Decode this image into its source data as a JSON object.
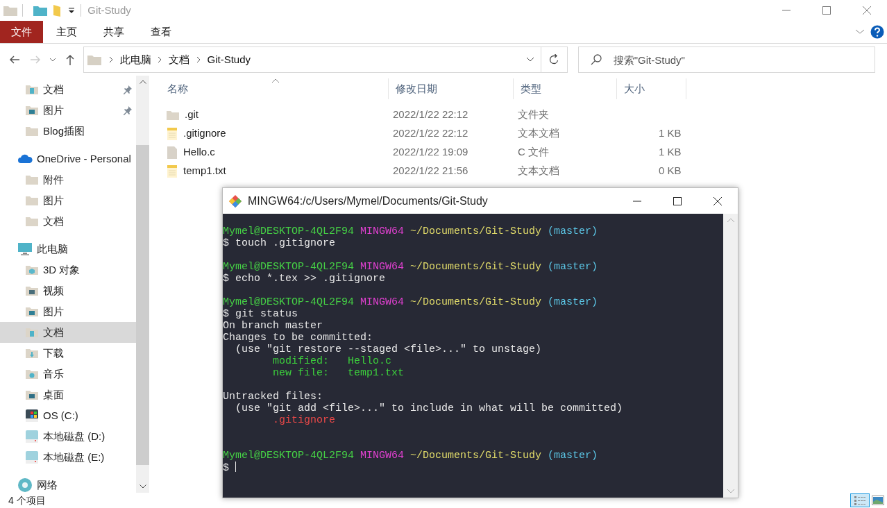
{
  "window": {
    "title": "Git-Study"
  },
  "ribbon": {
    "tabs": [
      {
        "label": "文件",
        "selected": true
      },
      {
        "label": "主页",
        "selected": false
      },
      {
        "label": "共享",
        "selected": false
      },
      {
        "label": "查看",
        "selected": false
      }
    ]
  },
  "address": {
    "breadcrumb": [
      "此电脑",
      "文档",
      "Git-Study"
    ]
  },
  "search": {
    "placeholder": "搜索\"Git-Study\""
  },
  "sidebar": {
    "items": [
      {
        "label": "文档",
        "kind": "documents",
        "pinned": true,
        "selected": false
      },
      {
        "label": "图片",
        "kind": "pictures",
        "pinned": true,
        "selected": false
      },
      {
        "label": "Blog插图",
        "kind": "folder",
        "pinned": false,
        "selected": false
      },
      {
        "label": "OneDrive - Personal",
        "kind": "onedrive",
        "selected": false,
        "children": [
          {
            "label": "附件",
            "kind": "folder",
            "selected": false
          },
          {
            "label": "图片",
            "kind": "folder",
            "selected": false
          },
          {
            "label": "文档",
            "kind": "folder",
            "selected": false
          }
        ]
      },
      {
        "label": "此电脑",
        "kind": "computer",
        "selected": false,
        "children": [
          {
            "label": "3D 对象",
            "kind": "objects3d",
            "selected": false
          },
          {
            "label": "视频",
            "kind": "videos",
            "selected": false
          },
          {
            "label": "图片",
            "kind": "pictures",
            "selected": false
          },
          {
            "label": "文档",
            "kind": "documents",
            "selected": true
          },
          {
            "label": "下载",
            "kind": "downloads",
            "selected": false
          },
          {
            "label": "音乐",
            "kind": "music",
            "selected": false
          },
          {
            "label": "桌面",
            "kind": "desktop",
            "selected": false
          },
          {
            "label": "OS (C:)",
            "kind": "os-drive",
            "selected": false
          },
          {
            "label": "本地磁盘 (D:)",
            "kind": "drive",
            "selected": false
          },
          {
            "label": "本地磁盘 (E:)",
            "kind": "drive",
            "selected": false
          }
        ]
      },
      {
        "label": "网络",
        "kind": "network",
        "selected": false
      }
    ]
  },
  "files": {
    "columns": [
      "名称",
      "修改日期",
      "类型",
      "大小"
    ],
    "rows": [
      {
        "name": ".git",
        "kind": "folder",
        "modified": "2022/1/22 22:12",
        "type": "文件夹"
      },
      {
        "name": ".gitignore",
        "kind": "text",
        "modified": "2022/1/22 22:12",
        "type": "文本文档",
        "size": "1 KB"
      },
      {
        "name": "Hello.c",
        "kind": "c-file",
        "modified": "2022/1/22 19:09",
        "type": "C 文件",
        "size": "1 KB"
      },
      {
        "name": "temp1.txt",
        "kind": "text",
        "modified": "2022/1/22 21:56",
        "type": "文本文档",
        "size": "0 KB"
      }
    ]
  },
  "status_bar": {
    "count": "4 个项目"
  },
  "terminal": {
    "title": "MINGW64:/c/Users/Mymel/Documents/Git-Study",
    "lines": [
      {
        "kind": "text",
        "segments": [
          {
            "text": "Mymel@DESKTOP-4QL2F94",
            "kind": "user"
          },
          {
            "text": " MINGW64",
            "kind": "host"
          },
          {
            "text": " ~/Documents/Git-Study",
            "kind": "path"
          },
          {
            "text": " (master)",
            "kind": "branch"
          }
        ]
      },
      {
        "kind": "text",
        "segments": [
          {
            "text": "$ touch .gitignore",
            "kind": "plain"
          }
        ]
      },
      {
        "kind": "blank"
      },
      {
        "kind": "text",
        "segments": [
          {
            "text": "Mymel@DESKTOP-4QL2F94",
            "kind": "user"
          },
          {
            "text": " MINGW64",
            "kind": "host"
          },
          {
            "text": " ~/Documents/Git-Study",
            "kind": "path"
          },
          {
            "text": " (master)",
            "kind": "branch"
          }
        ]
      },
      {
        "kind": "text",
        "segments": [
          {
            "text": "$ echo *.tex >> .gitignore",
            "kind": "plain"
          }
        ]
      },
      {
        "kind": "blank"
      },
      {
        "kind": "text",
        "segments": [
          {
            "text": "Mymel@DESKTOP-4QL2F94",
            "kind": "user"
          },
          {
            "text": " MINGW64",
            "kind": "host"
          },
          {
            "text": " ~/Documents/Git-Study",
            "kind": "path"
          },
          {
            "text": " (master)",
            "kind": "branch"
          }
        ]
      },
      {
        "kind": "text",
        "segments": [
          {
            "text": "$ git status",
            "kind": "plain"
          }
        ]
      },
      {
        "kind": "text",
        "segments": [
          {
            "text": "On branch master",
            "kind": "plain"
          }
        ]
      },
      {
        "kind": "text",
        "segments": [
          {
            "text": "Changes to be committed:",
            "kind": "plain"
          }
        ]
      },
      {
        "kind": "text",
        "segments": [
          {
            "text": "  (use \"git restore --staged <file>...\" to unstage)",
            "kind": "plain"
          }
        ]
      },
      {
        "kind": "text",
        "segments": [
          {
            "text": "        modified:   Hello.c",
            "kind": "staged"
          }
        ]
      },
      {
        "kind": "text",
        "segments": [
          {
            "text": "        new file:   temp1.txt",
            "kind": "staged"
          }
        ]
      },
      {
        "kind": "blank"
      },
      {
        "kind": "text",
        "segments": [
          {
            "text": "Untracked files:",
            "kind": "plain"
          }
        ]
      },
      {
        "kind": "text",
        "segments": [
          {
            "text": "  (use \"git add <file>...\" to include in what will be committed)",
            "kind": "plain"
          }
        ]
      },
      {
        "kind": "text",
        "segments": [
          {
            "text": "        .gitignore",
            "kind": "untracked"
          }
        ]
      },
      {
        "kind": "blank"
      },
      {
        "kind": "blank"
      },
      {
        "kind": "text",
        "segments": [
          {
            "text": "Mymel@DESKTOP-4QL2F94",
            "kind": "user"
          },
          {
            "text": " MINGW64",
            "kind": "host"
          },
          {
            "text": " ~/Documents/Git-Study",
            "kind": "path"
          },
          {
            "text": " (master)",
            "kind": "branch"
          }
        ]
      },
      {
        "kind": "prompt",
        "segments": [
          {
            "text": "$",
            "kind": "plain"
          }
        ]
      }
    ]
  }
}
